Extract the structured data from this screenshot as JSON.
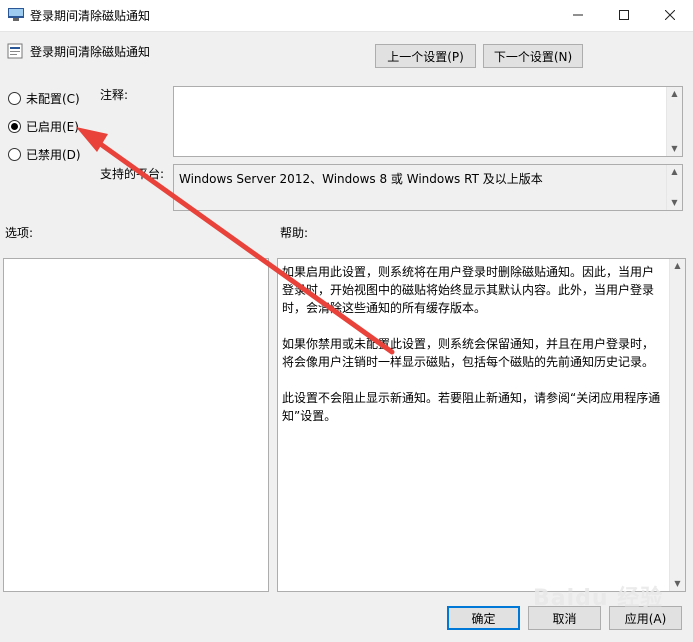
{
  "window": {
    "title": "登录期间清除磁贴通知",
    "controls": [
      "minimize-icon",
      "maximize-icon",
      "close-icon"
    ]
  },
  "header": {
    "title": "登录期间清除磁贴通知",
    "prev_label": "上一个设置(P)",
    "next_label": "下一个设置(N)"
  },
  "state": {
    "options": [
      {
        "label": "未配置(C)",
        "checked": false
      },
      {
        "label": "已启用(E)",
        "checked": true
      },
      {
        "label": "已禁用(D)",
        "checked": false
      }
    ]
  },
  "comment": {
    "label": "注释:",
    "value": ""
  },
  "supported": {
    "label": "支持的平台:",
    "value": "Windows Server 2012、Windows 8 或 Windows RT 及以上版本"
  },
  "options_section": {
    "label": "选项:"
  },
  "help": {
    "label": "帮助:",
    "paragraphs": [
      "如果启用此设置，则系统将在用户登录时删除磁贴通知。因此，当用户登录时，开始视图中的磁贴将始终显示其默认内容。此外，当用户登录时，会清除这些通知的所有缓存版本。",
      "如果你禁用或未配置此设置，则系统会保留通知，并且在用户登录时，将会像用户注销时一样显示磁贴，包括每个磁贴的先前通知历史记录。",
      "此设置不会阻止显示新通知。若要阻止新通知，请参阅“关闭应用程序通知”设置。"
    ]
  },
  "footer": {
    "ok_label": "确定",
    "cancel_label": "取消",
    "apply_label": "应用(A)"
  },
  "watermark": {
    "text": "Baidu 经验"
  },
  "colors": {
    "accent": "#0078d7",
    "arrow": "#e8423a"
  }
}
